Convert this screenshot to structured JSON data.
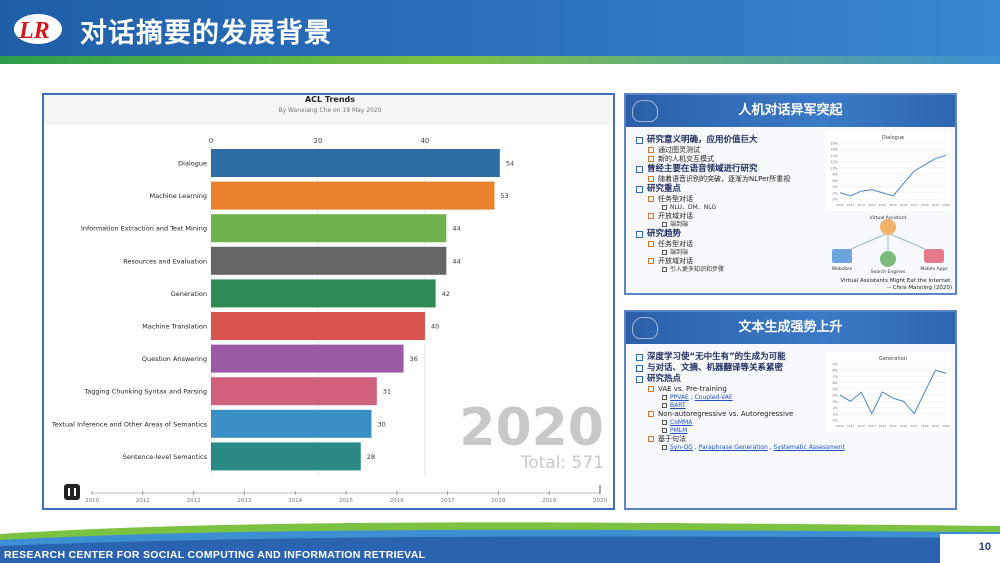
{
  "slide": {
    "title": "对话摘要的发展背景",
    "footer": "RESEARCH CENTER FOR SOCIAL COMPUTING AND INFORMATION RETRIEVAL",
    "page_number": "10",
    "colors": {
      "header": "#2c72c0",
      "accent_green": "#7cc242",
      "frame": "#3f6fb6"
    }
  },
  "chart_data": {
    "type": "bar",
    "title": "ACL Trends",
    "subtitle": "By Wanxiang Che on 19 May 2020",
    "categories": [
      "Dialogue",
      "Machine Learning",
      "Information Extraction and Text Mining",
      "Resources and Evaluation",
      "Generation",
      "Machine Translation",
      "Question Answering",
      "Tagging Chunking Syntax and Parsing",
      "Textual Inference and Other Areas of Semantics",
      "Sentence-level Semantics"
    ],
    "values": [
      54,
      53,
      44,
      44,
      42,
      40,
      36,
      31,
      30,
      28
    ],
    "colors": [
      "#2e6da4",
      "#e8822a",
      "#6fb24a",
      "#666666",
      "#2e8b57",
      "#d9534f",
      "#9b59a6",
      "#d0607c",
      "#3a8fc7",
      "#2a8b86"
    ],
    "xticks": [
      0,
      20,
      40
    ],
    "xlim": [
      0,
      66
    ],
    "year_label": "2020",
    "total_label": "Total: 571",
    "timeline": [
      "2010",
      "2011",
      "2012",
      "2013",
      "2014",
      "2015",
      "2016",
      "2017",
      "2018",
      "2019",
      "2020"
    ]
  },
  "panel1": {
    "title": "人机对话异军突起",
    "items": [
      {
        "level": 1,
        "text": "研究意义明确，应用价值巨大"
      },
      {
        "level": 2,
        "text": "通过图灵测试"
      },
      {
        "level": 2,
        "text": "新的人机交互模式"
      },
      {
        "level": 1,
        "text": "曾经主要在语音领域进行研究"
      },
      {
        "level": 2,
        "text": "随着语音识别的突破，逐渐为NLPer所重视"
      },
      {
        "level": 1,
        "text": "研究重点"
      },
      {
        "level": 2,
        "text": "任务型对话"
      },
      {
        "level": 3,
        "text": "NLU、DM、NLG"
      },
      {
        "level": 2,
        "text": "开放域对话"
      },
      {
        "level": 3,
        "text": "端到端"
      },
      {
        "level": 1,
        "text": "研究趋势"
      },
      {
        "level": 2,
        "text": "任务型对话"
      },
      {
        "level": 3,
        "text": "端到端"
      },
      {
        "level": 2,
        "text": "开放域对话"
      },
      {
        "level": 3,
        "text": "引入更多知识和步骤"
      }
    ],
    "mini_chart": {
      "title": "Dialogue",
      "x": [
        "2010",
        "2011",
        "2012",
        "2013",
        "2014",
        "2015",
        "2016",
        "2017",
        "2018",
        "2019",
        "2020"
      ],
      "values": [
        2,
        1,
        2.5,
        3,
        2,
        1,
        5,
        9,
        11,
        13,
        14
      ],
      "yticks": [
        "0%",
        "2%",
        "4%",
        "6%",
        "8%",
        "10%",
        "12%",
        "14%",
        "16%",
        "18%"
      ]
    },
    "va_labels": {
      "assistant": "Virtual Assistant",
      "websites": "Websites",
      "search": "Search Engines",
      "apps": "Mobile Apps"
    },
    "quote": "Virtual Assistants Might Eat the Internet.",
    "quote_author": "-- Chris Manning (2020)"
  },
  "panel2": {
    "title": "文本生成强势上升",
    "items": [
      {
        "level": 1,
        "text": "深度学习使“无中生有”的生成为可能"
      },
      {
        "level": 1,
        "text": "与对话、文摘、机器翻译等关系紧密"
      },
      {
        "level": 1,
        "text": "研究热点"
      },
      {
        "level": 2,
        "text": "VAE vs. Pre-training"
      },
      {
        "level": 3,
        "links": [
          "PPVAE",
          "Coupled-VAE"
        ]
      },
      {
        "level": 3,
        "links": [
          "BART"
        ]
      },
      {
        "level": 2,
        "text": "Non-autoregressive vs. Autoregressive"
      },
      {
        "level": 3,
        "links": [
          "CoMMA"
        ]
      },
      {
        "level": 3,
        "links": [
          "PMLM"
        ]
      },
      {
        "level": 2,
        "text": "基于句法"
      },
      {
        "level": 3,
        "links": [
          "Syn-QG",
          "Paraphrase Generation",
          "Systematic Assessment"
        ]
      }
    ],
    "mini_chart": {
      "title": "Generation",
      "x": [
        "2010",
        "2011",
        "2012",
        "2013",
        "2014",
        "2015",
        "2016",
        "2017",
        "2018",
        "2019",
        "2020"
      ],
      "values": [
        4,
        3,
        4.5,
        1,
        4.5,
        3.5,
        3,
        1,
        4.5,
        8,
        7.5
      ],
      "yticks": [
        "0%",
        "1%",
        "2%",
        "3%",
        "4%",
        "5%",
        "6%",
        "7%",
        "8%",
        "9%"
      ]
    }
  }
}
